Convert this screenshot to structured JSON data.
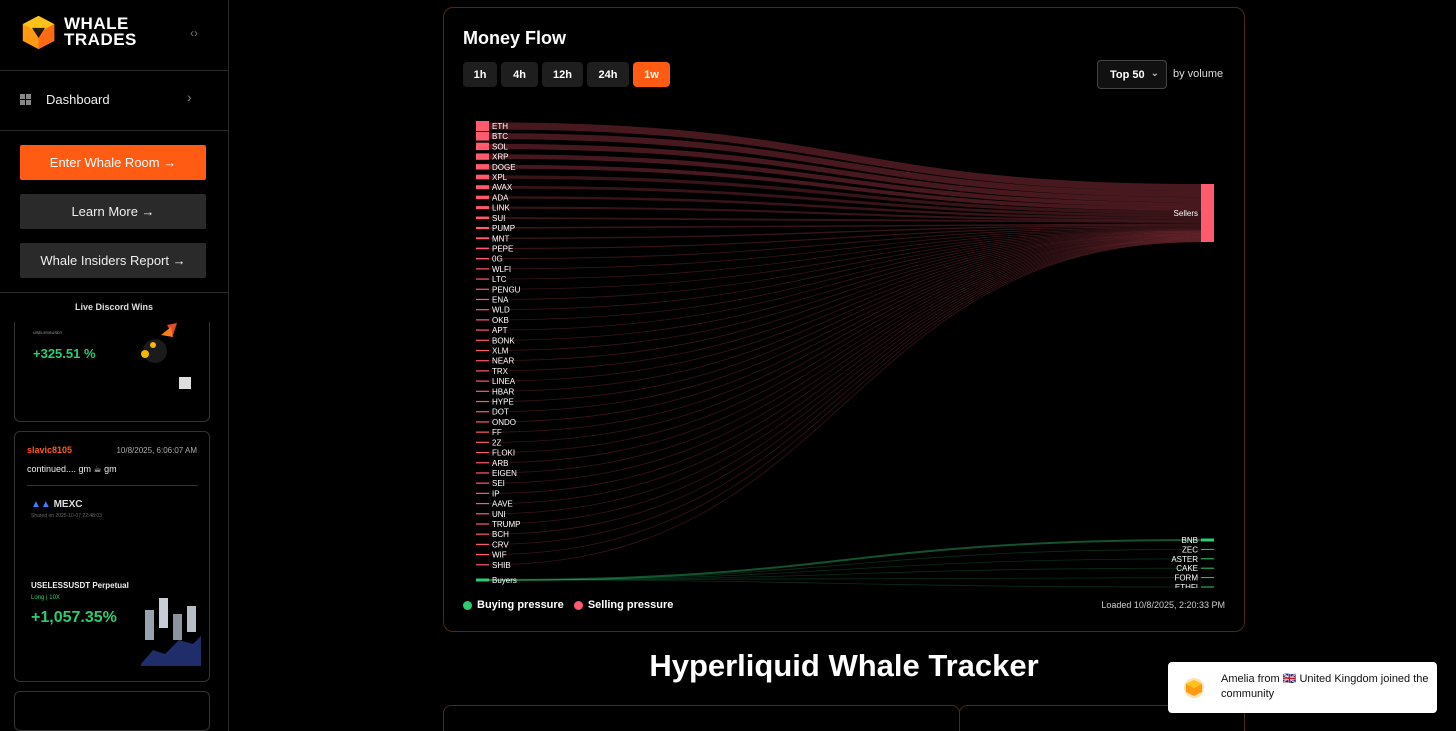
{
  "brand": {
    "line1": "WHALE",
    "line2": "TRADES",
    "accent": "#ff5b12"
  },
  "sidebar": {
    "toggle_glyph": "‹›",
    "nav": [
      {
        "label": "Dashboard",
        "icon": "grid-icon"
      }
    ],
    "buttons": {
      "enter": "Enter Whale Room →",
      "learn": "Learn More →",
      "report": "Whale Insiders Report →"
    },
    "discord_title": "Live Discord Wins",
    "card1": {
      "pair": "USELESSUSDT",
      "pct": "+325.51 %"
    },
    "card2": {
      "user": "slavic8105",
      "time": "10/8/2025, 6:06:07 AM",
      "message": "continued.... gm ☕ gm",
      "exchange": "MEXC",
      "shared": "Shared on 2025-10-07 22:48:03",
      "pair": "USELESSUSDT Perpetual",
      "side": "Long | 10X",
      "pct": "+1,057.35%"
    }
  },
  "money_flow": {
    "title": "Money Flow",
    "timeframes": [
      "1h",
      "4h",
      "12h",
      "24h",
      "1w"
    ],
    "active_timeframe": "1w",
    "top_select": "Top 50",
    "by_volume": "by volume",
    "legend": {
      "buy": "Buying pressure",
      "sell": "Selling pressure"
    },
    "loaded": "Loaded 10/8/2025, 2:20:33 PM",
    "colors": {
      "sell": "#ff5a6e",
      "buy": "#2ecc71"
    }
  },
  "chart_data": {
    "type": "sankey",
    "sell_sources": [
      "ETH",
      "BTC",
      "SOL",
      "XRP",
      "DOGE",
      "XPL",
      "AVAX",
      "ADA",
      "LINK",
      "SUI",
      "PUMP",
      "MNT",
      "PEPE",
      "0G",
      "WLFI",
      "LTC",
      "PENGU",
      "ENA",
      "WLD",
      "OKB",
      "APT",
      "BONK",
      "XLM",
      "NEAR",
      "TRX",
      "LINEA",
      "HBAR",
      "HYPE",
      "DOT",
      "ONDO",
      "FF",
      "2Z",
      "FLOKI",
      "ARB",
      "EIGEN",
      "SEI",
      "IP",
      "AAVE",
      "UNI",
      "TRUMP",
      "BCH",
      "CRV",
      "WIF",
      "SHIB"
    ],
    "sell_target": "Sellers",
    "buy_source": "Buyers",
    "buy_targets": [
      "BNB",
      "ZEC",
      "ASTER",
      "CAKE",
      "FORM",
      "ETHFI"
    ]
  },
  "section_title": "Hyperliquid Whale Tracker",
  "toast": {
    "text": "Amelia from 🇬🇧 United Kingdom joined the community"
  }
}
